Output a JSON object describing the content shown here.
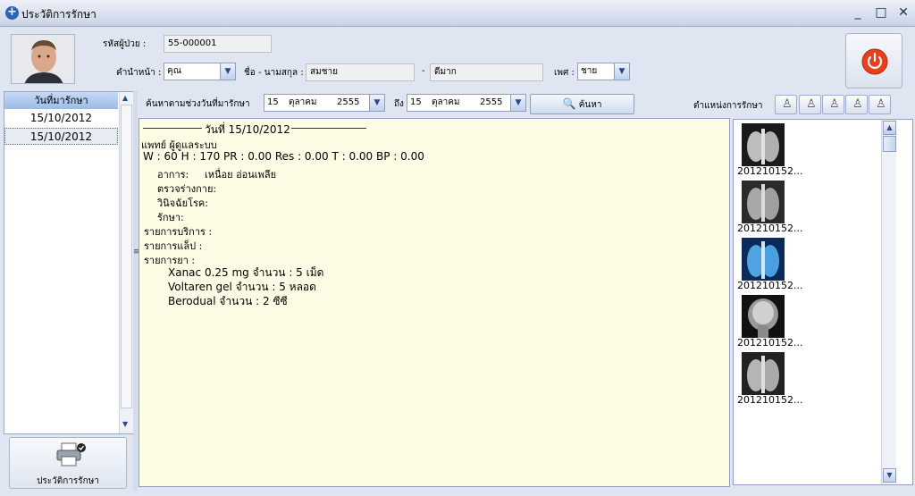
{
  "window": {
    "title": "ประวัติการรักษา",
    "minimize": "_",
    "maximize": "□",
    "close": "✕"
  },
  "patient": {
    "hn_label": "รหัสผู้ป่วย :",
    "hn_value": "55-000001",
    "prefix_label": "คำนำหน้า :",
    "prefix_value": "คุณ",
    "name_label": "ชื่อ - นามสกุล :",
    "first_name": "สมชาย",
    "dash": "-",
    "last_name": "ดีมาก",
    "sex_label": "เพศ :",
    "sex_value": "ชาย"
  },
  "visits": {
    "header": "วันที่มารักษา",
    "items": [
      "15/10/2012",
      "15/10/2012"
    ]
  },
  "print_button": {
    "label": "ประวัติการรักษา"
  },
  "search": {
    "range_label": "ค้นหาตามช่วงวันที่มารักษา",
    "from": {
      "day": "15",
      "month": "ตุลาคม",
      "year": "2555"
    },
    "to_label": "ถึง",
    "to": {
      "day": "15",
      "month": "ตุลาคม",
      "year": "2555"
    },
    "button_label": "ค้นหา",
    "position_label": "ตำแหน่งการรักษา"
  },
  "record": {
    "date_heading": "วันที่ 15/10/2012",
    "doctor": "แพทย์ ผู้ดูแลระบบ",
    "vitals": "W : 60   H : 170   PR : 0.00   Res : 0.00   T : 0.00   BP : 0.00",
    "symptom_label": "อาการ:",
    "symptom_value": "เหนื่อย อ่อนเพลีย",
    "exam_label": "ตรวจร่างกาย:",
    "diagnosis_label": "วินิจฉัยโรค:",
    "treatment_label": "รักษา:",
    "services_label": "รายการบริการ :",
    "lab_label": "รายการแล็ป :",
    "drugs_label": "รายการยา :",
    "drugs": [
      "Xanac 0.25 mg  จำนวน : 5 เม็ด",
      "Voltaren gel  จำนวน : 5 หลอด",
      "Berodual  จำนวน : 2 ซีซี"
    ]
  },
  "thumbnails": [
    {
      "label": "201210152...",
      "kind": "xray-chest"
    },
    {
      "label": "201210152...",
      "kind": "xray-chest"
    },
    {
      "label": "201210152...",
      "kind": "xray-chest-blue"
    },
    {
      "label": "201210152...",
      "kind": "mri-head"
    },
    {
      "label": "201210152...",
      "kind": "xray-chest"
    }
  ]
}
